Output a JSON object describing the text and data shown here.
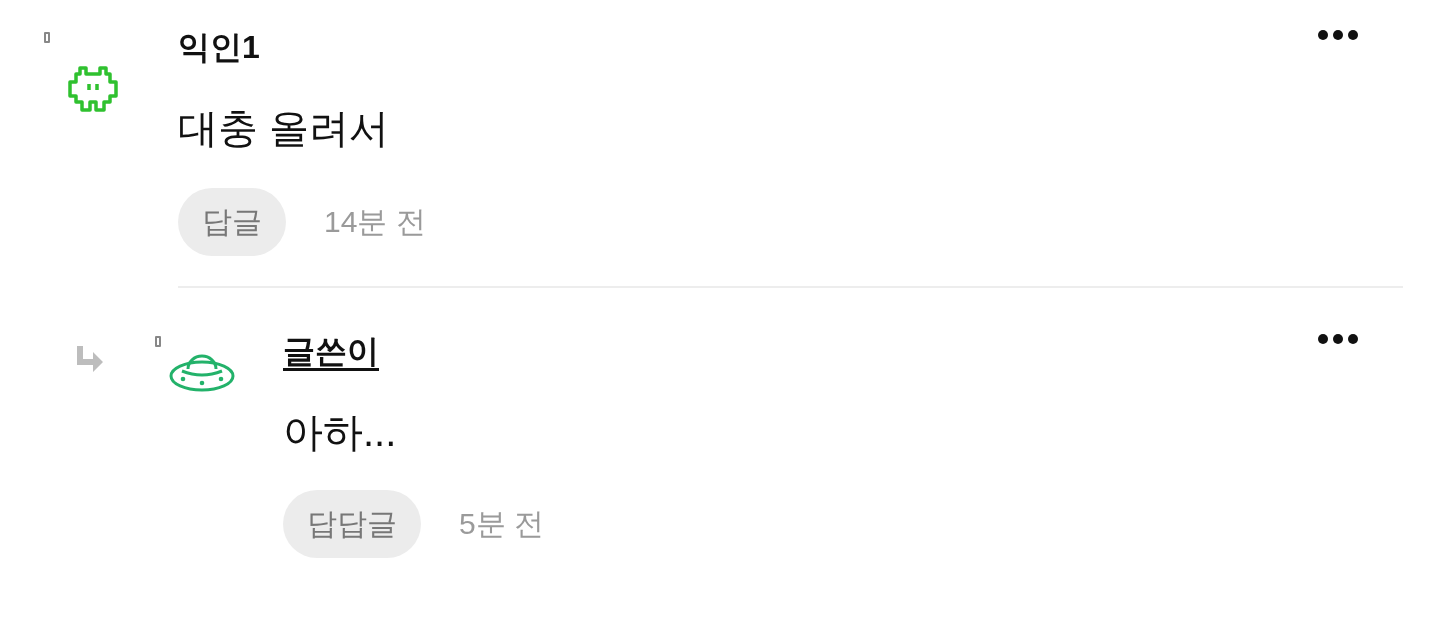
{
  "comments": [
    {
      "kind": "comment",
      "avatar": {
        "kind": "invader"
      },
      "author": "익인1",
      "is_author": false,
      "text": "대충 올려서",
      "reply_label": "답글",
      "time": "14분 전"
    },
    {
      "kind": "reply",
      "avatar": {
        "kind": "ufo"
      },
      "author": "글쓴이",
      "is_author": true,
      "text": "아하...",
      "reply_label": "답답글",
      "time": "5분 전"
    }
  ]
}
